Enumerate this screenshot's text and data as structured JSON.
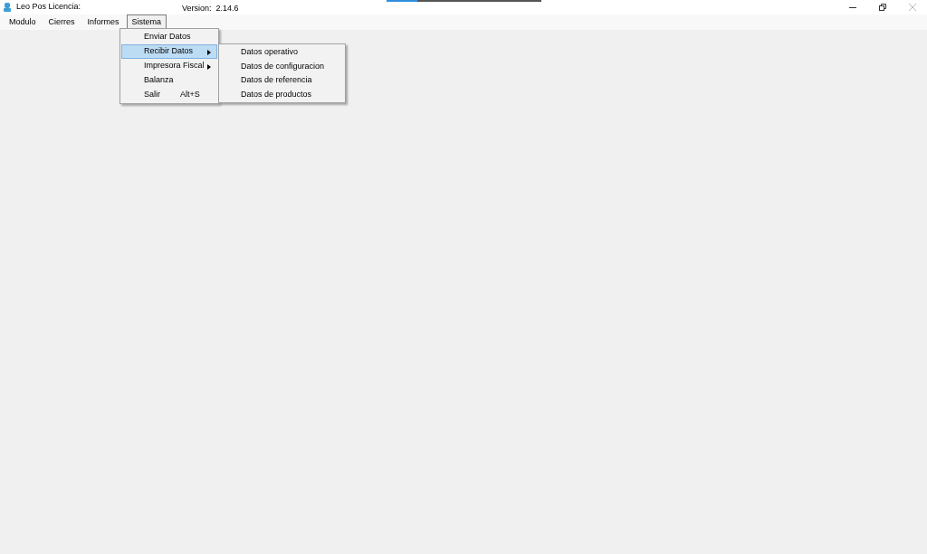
{
  "window": {
    "title": "Leo Pos Licencia:",
    "version": "Version:  2.14.6",
    "close_disabled": true
  },
  "progress": {
    "level": 0.2
  },
  "menubar": [
    {
      "label": "Modulo",
      "selected": false
    },
    {
      "label": "Cierres",
      "selected": false
    },
    {
      "label": "Informes",
      "selected": false
    },
    {
      "label": "Sistema",
      "selected": true
    }
  ],
  "dropdown": [
    {
      "label": "Enviar Datos",
      "selected": false,
      "submenu": false
    },
    {
      "label": "Recibir Datos",
      "selected": true,
      "submenu": true
    },
    {
      "label": "Impresora Fiscal",
      "selected": false,
      "submenu": true
    },
    {
      "label": "Balanza",
      "selected": false,
      "submenu": false
    },
    {
      "label": "Salir",
      "shortcut": "Alt+S",
      "selected": false,
      "submenu": false
    }
  ],
  "submenu": [
    {
      "label": "Datos operativo"
    },
    {
      "label": "Datos de configuracion"
    },
    {
      "label": "Datos de referencia"
    },
    {
      "label": "Datos de productos"
    }
  ]
}
